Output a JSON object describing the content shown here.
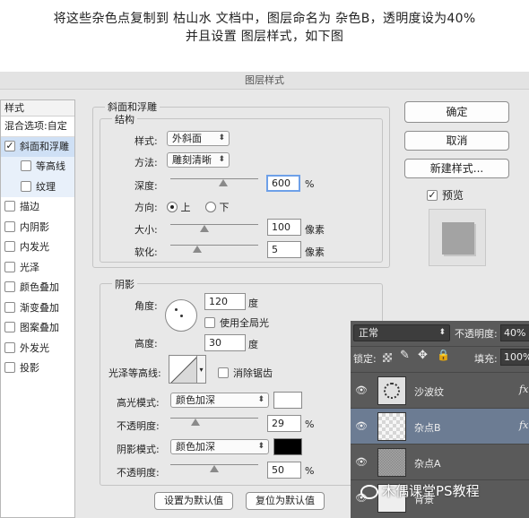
{
  "instruction": {
    "line1": "将这些杂色点复制到 枯山水 文档中，图层命名为 杂色B，透明度设为40%",
    "line2": "并且设置 图层样式，如下图"
  },
  "dialog": {
    "title": "图层样式",
    "styles_header": "样式",
    "blend_options": "混合选项:自定",
    "items": [
      {
        "label": "斜面和浮雕",
        "checked": true
      },
      {
        "label": "等高线",
        "checked": false
      },
      {
        "label": "纹理",
        "checked": false
      },
      {
        "label": "描边",
        "checked": false
      },
      {
        "label": "内阴影",
        "checked": false
      },
      {
        "label": "内发光",
        "checked": false
      },
      {
        "label": "光泽",
        "checked": false
      },
      {
        "label": "颜色叠加",
        "checked": false
      },
      {
        "label": "渐变叠加",
        "checked": false
      },
      {
        "label": "图案叠加",
        "checked": false
      },
      {
        "label": "外发光",
        "checked": false
      },
      {
        "label": "投影",
        "checked": false
      }
    ],
    "bevel": {
      "section_title": "斜面和浮雕",
      "structure_title": "结构",
      "style_label": "样式:",
      "style_value": "外斜面",
      "technique_label": "方法:",
      "technique_value": "雕刻清晰",
      "depth_label": "深度:",
      "depth_value": "600",
      "depth_unit": "%",
      "depth_fraction": 0.6,
      "direction_label": "方向:",
      "direction_up": "上",
      "direction_down": "下",
      "size_label": "大小:",
      "size_value": "100",
      "size_unit": "像素",
      "size_fraction": 0.39,
      "soften_label": "软化:",
      "soften_value": "5",
      "soften_unit": "像素",
      "soften_fraction": 0.31
    },
    "shading": {
      "section_title": "阴影",
      "angle_label": "角度:",
      "angle_value": "120",
      "angle_unit": "度",
      "global_light_label": "使用全局光",
      "altitude_label": "高度:",
      "altitude_value": "30",
      "altitude_unit": "度",
      "gloss_label": "光泽等高线:",
      "antialias_label": "消除锯齿",
      "highlight_label": "高光模式:",
      "highlight_mode": "颜色加深",
      "highlight_color": "#ffffff",
      "highlight_opacity_label": "不透明度:",
      "highlight_opacity": "29",
      "highlight_opacity_fraction": 0.29,
      "highlight_unit": "%",
      "shadow_label": "阴影模式:",
      "shadow_mode": "颜色加深",
      "shadow_color": "#000000",
      "shadow_opacity_label": "不透明度:",
      "shadow_opacity": "50",
      "shadow_opacity_fraction": 0.5,
      "shadow_unit": "%"
    },
    "buttons": {
      "ok": "确定",
      "cancel": "取消",
      "new_style": "新建样式...",
      "preview": "预览",
      "set_default": "设置为默认值",
      "reset_default": "复位为默认值"
    }
  },
  "layers_panel": {
    "blend_mode": "正常",
    "opacity_label": "不透明度:",
    "opacity_value": "40%",
    "lock_label": "锁定:",
    "fill_label": "填充:",
    "fill_value": "100%",
    "layers": [
      {
        "name": "沙波纹",
        "fx": "fx"
      },
      {
        "name": "杂点B",
        "fx": "fx",
        "selected": true
      },
      {
        "name": "杂点A",
        "fx": ""
      },
      {
        "name": "背景",
        "fx": ""
      }
    ]
  },
  "watermark": "木偶课堂PS教程"
}
